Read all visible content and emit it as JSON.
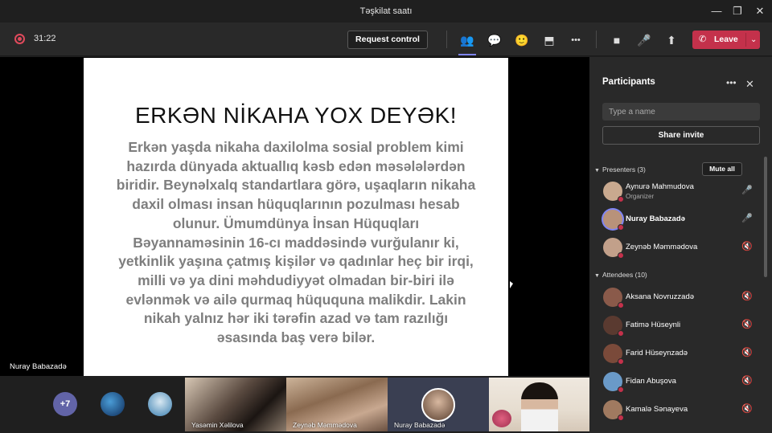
{
  "window": {
    "title": "Təşkilat saatı",
    "controls": {
      "minimize": "—",
      "maximize": "❐",
      "close": "✕"
    }
  },
  "toolbar": {
    "timer": "31:22",
    "request_control": "Request control",
    "icons": {
      "people": "👥",
      "chat": "💬",
      "reactions": "🙂",
      "rooms": "⬒",
      "more": "•••",
      "camera": "■",
      "mic": "🎤",
      "share": "⬆"
    },
    "leave": {
      "label": "Leave",
      "phone": "✆",
      "caret": "⌄"
    }
  },
  "slide": {
    "title": "ERKƏN NİKAHA YOX DEYƏK!",
    "lines": [
      "Erkən yaşda nikaha daxilolma sosial problem kimi",
      "hazırda dünyada aktuallıq kəsb edən məsələlərdən",
      "biridir. Beynəlxalq standartlara görə, uşaqların nikaha",
      "daxil olması insan hüquqlarının pozulması hesab",
      "olunur. Ümumdünya İnsan Hüquqları",
      "Bəyannaməsinin 16-cı maddəsində vurğulanır ki,",
      "yetkinlik yaşına çatmış kişilər və qadınlar heç bir irqi,",
      "milli və ya dini məhdudiyyət olmadan bir-biri ilə",
      "evlənmək və ailə qurmaq hüququna malikdir. Lakin",
      "nikah yalnız hər iki tərəfin azad və tam razılığı",
      "əsasında baş verə bilər."
    ]
  },
  "stage": {
    "presenter_label": "Nuray Babazadə"
  },
  "gallery": {
    "overflow": "+7",
    "tiles": [
      {
        "name": "Yasəmin Xəlilova",
        "mic": "🎤"
      },
      {
        "name": "Zeynəb Məmmədova",
        "mic": "🎤"
      },
      {
        "name": "Nuray Babazadə",
        "mic": ""
      },
      {
        "name": "",
        "mic": ""
      }
    ]
  },
  "participants": {
    "title": "Participants",
    "more": "•••",
    "close": "✕",
    "search_placeholder": "Type a name",
    "share_invite": "Share invite",
    "presenters_label": "Presenters (3)",
    "mute_all": "Mute all",
    "attendees_label": "Attendees (10)",
    "presenters": [
      {
        "name": "Aynurə Mahmudova",
        "role": "Organizer",
        "mic": "🎤",
        "color": "#c9a98f"
      },
      {
        "name": "Nuray Babazadə",
        "role": "",
        "mic": "🎤",
        "color": "#b8927a"
      },
      {
        "name": "Zeynəb Məmmədova",
        "role": "",
        "mic": "🔇",
        "color": "#c2a08a"
      }
    ],
    "attendees": [
      {
        "name": "Aksana Novruzzadə",
        "mic": "🔇",
        "color": "#8a5a4a"
      },
      {
        "name": "Fatimə Hüseynli",
        "mic": "🔇",
        "color": "#5a3a30"
      },
      {
        "name": "Farid Hüseynzadə",
        "mic": "🔇",
        "color": "#7a4a3a"
      },
      {
        "name": "Fidan Abuşova",
        "mic": "🔇",
        "color": "#6a9ac8"
      },
      {
        "name": "Kamalə Sənayeva",
        "mic": "🔇",
        "color": "#a07a60"
      }
    ]
  }
}
